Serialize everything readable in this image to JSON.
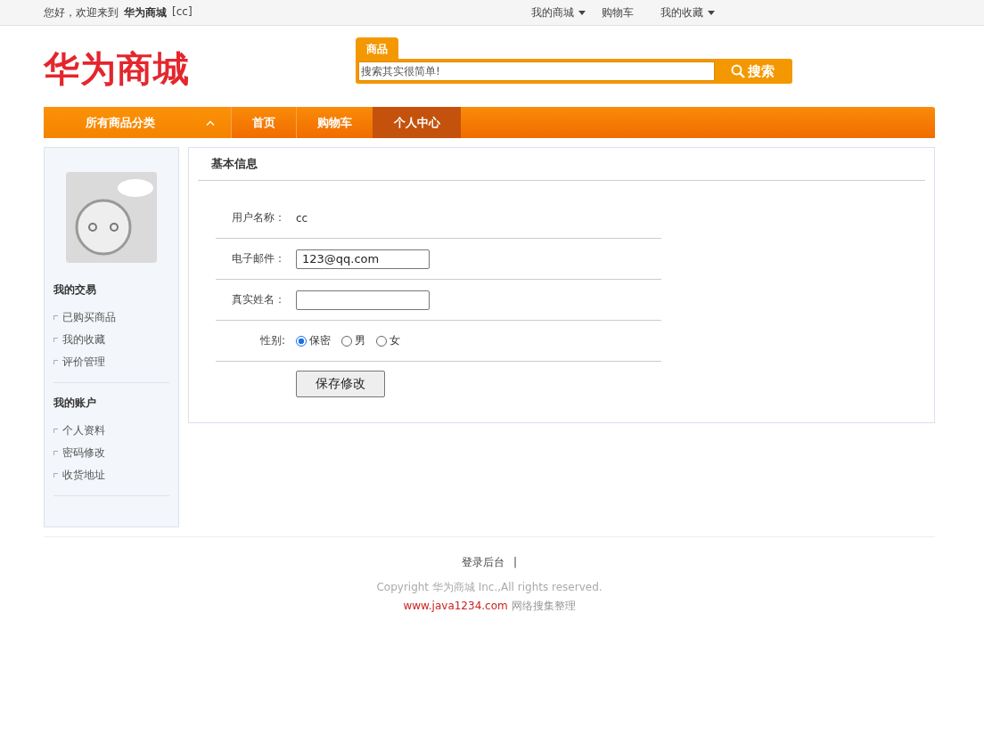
{
  "topbar": {
    "greeting": "您好，欢迎来到",
    "site_name": "华为商城",
    "user": "[cc]",
    "links": [
      {
        "label": "我的商城",
        "dropdown": true
      },
      {
        "label": "购物车",
        "dropdown": false
      },
      {
        "label": "我的收藏",
        "dropdown": true
      }
    ]
  },
  "header": {
    "logo": "华为商城",
    "search": {
      "tab": "商品",
      "placeholder": "搜索其实很简单!",
      "button": "搜索"
    }
  },
  "nav": {
    "category": "所有商品分类",
    "items": [
      {
        "label": "首页",
        "selected": false
      },
      {
        "label": "购物车",
        "selected": false
      },
      {
        "label": "个人中心",
        "selected": true
      }
    ]
  },
  "sidebar": {
    "sections": [
      {
        "title": "我的交易",
        "items": [
          "已购买商品",
          "我的收藏",
          "评价管理"
        ]
      },
      {
        "title": "我的账户",
        "items": [
          "个人资料",
          "密码修改",
          "收货地址"
        ]
      }
    ]
  },
  "form": {
    "title": "基本信息",
    "rows": [
      {
        "kind": "text",
        "label": "用户名称：",
        "value": "cc"
      },
      {
        "kind": "input",
        "label": "电子邮件：",
        "value": "123@qq.com"
      },
      {
        "kind": "input",
        "label": "真实姓名：",
        "value": ""
      },
      {
        "kind": "radio",
        "label": "性别:",
        "options": [
          {
            "label": "保密",
            "selected": true
          },
          {
            "label": "男",
            "selected": false
          },
          {
            "label": "女",
            "selected": false
          }
        ]
      }
    ],
    "button": "保存修改"
  },
  "footer": {
    "links": [
      "登录后台"
    ],
    "separator": "|",
    "copyright": "Copyright 华为商城 Inc.,All rights reserved.",
    "credit_link": "www.java1234.com",
    "credit_text": "网络搜集整理"
  }
}
